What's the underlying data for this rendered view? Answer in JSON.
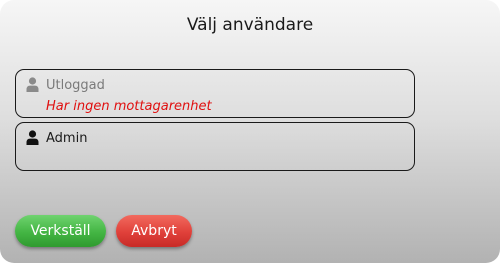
{
  "dialog": {
    "title": "Välj användare"
  },
  "users": [
    {
      "name": "Utloggad",
      "status": "Har ingen mottagarenhet",
      "icon": "user-icon",
      "icon_color": "#8a8a8a"
    },
    {
      "name": "Admin",
      "status": "",
      "icon": "user-icon",
      "icon_color": "#111111"
    }
  ],
  "actions": {
    "apply_label": "Verkställ",
    "cancel_label": "Avbryt"
  },
  "colors": {
    "apply": "#43b543",
    "cancel": "#e0403a",
    "status_text": "#e01010"
  }
}
